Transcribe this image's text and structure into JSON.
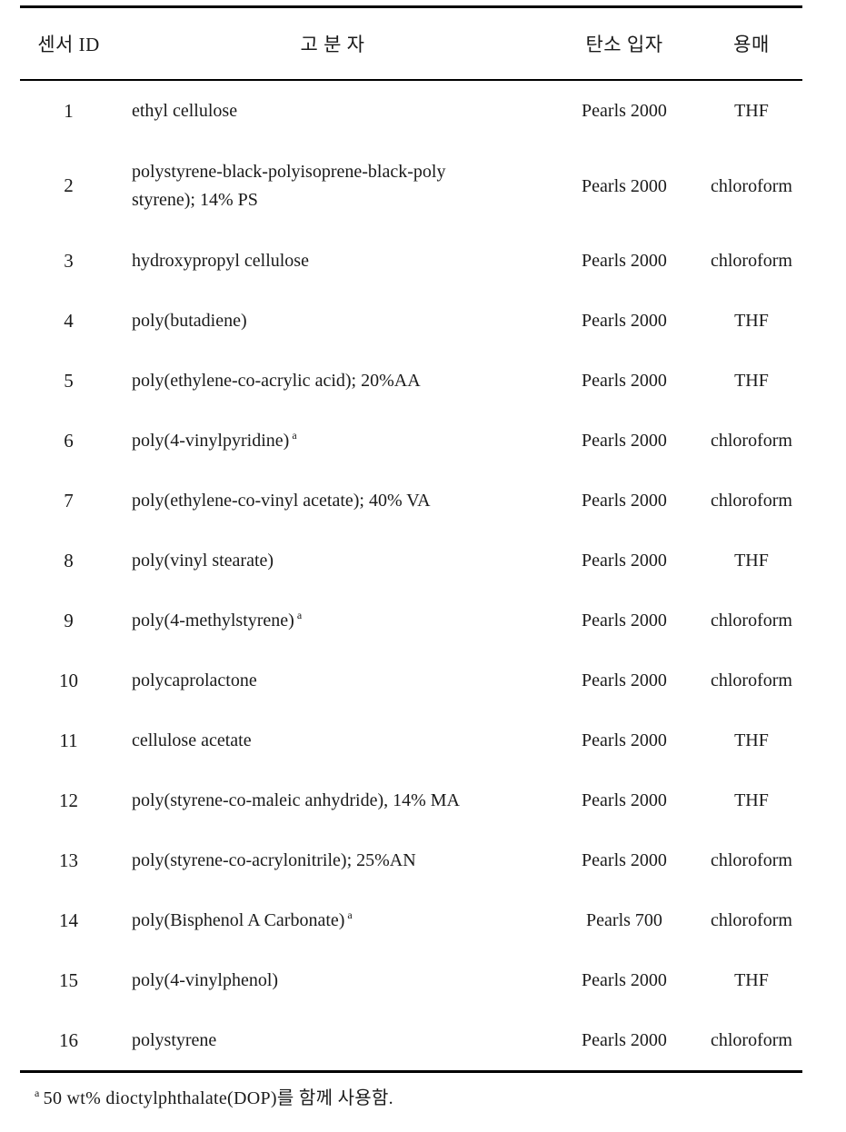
{
  "table": {
    "headers": {
      "sensor_id": "센서 ID",
      "polymer": "고 분 자",
      "carbon": "탄소 입자",
      "solvent": "용매"
    },
    "rows": [
      {
        "id": "1",
        "polymer_line1": "ethyl cellulose",
        "polymer_line2": "",
        "footnote_mark": "",
        "carbon": "Pearls 2000",
        "solvent": "THF"
      },
      {
        "id": "2",
        "polymer_line1": "polystyrene-black-polyisoprene-black-poly",
        "polymer_line2": "styrene); 14% PS",
        "footnote_mark": "",
        "carbon": "Pearls 2000",
        "solvent": "chloroform"
      },
      {
        "id": "3",
        "polymer_line1": "hydroxypropyl cellulose",
        "polymer_line2": "",
        "footnote_mark": "",
        "carbon": "Pearls 2000",
        "solvent": "chloroform"
      },
      {
        "id": "4",
        "polymer_line1": "poly(butadiene)",
        "polymer_line2": "",
        "footnote_mark": "",
        "carbon": "Pearls 2000",
        "solvent": "THF"
      },
      {
        "id": "5",
        "polymer_line1": "poly(ethylene-co-acrylic acid); 20%AA",
        "polymer_line2": "",
        "footnote_mark": "",
        "carbon": "Pearls 2000",
        "solvent": "THF"
      },
      {
        "id": "6",
        "polymer_line1": "poly(4-vinylpyridine)",
        "polymer_line2": "",
        "footnote_mark": "a",
        "carbon": "Pearls 2000",
        "solvent": "chloroform"
      },
      {
        "id": "7",
        "polymer_line1": "poly(ethylene-co-vinyl acetate); 40% VA",
        "polymer_line2": "",
        "footnote_mark": "",
        "carbon": "Pearls 2000",
        "solvent": "chloroform"
      },
      {
        "id": "8",
        "polymer_line1": "poly(vinyl stearate)",
        "polymer_line2": "",
        "footnote_mark": "",
        "carbon": "Pearls 2000",
        "solvent": "THF"
      },
      {
        "id": "9",
        "polymer_line1": "poly(4-methylstyrene)",
        "polymer_line2": "",
        "footnote_mark": "a",
        "carbon": "Pearls 2000",
        "solvent": "chloroform"
      },
      {
        "id": "10",
        "polymer_line1": "polycaprolactone",
        "polymer_line2": "",
        "footnote_mark": "",
        "carbon": "Pearls 2000",
        "solvent": "chloroform"
      },
      {
        "id": "11",
        "polymer_line1": "cellulose acetate",
        "polymer_line2": "",
        "footnote_mark": "",
        "carbon": "Pearls 2000",
        "solvent": "THF"
      },
      {
        "id": "12",
        "polymer_line1": "poly(styrene-co-maleic anhydride), 14% MA",
        "polymer_line2": "",
        "footnote_mark": "",
        "carbon": "Pearls 2000",
        "solvent": "THF"
      },
      {
        "id": "13",
        "polymer_line1": "poly(styrene-co-acrylonitrile); 25%AN",
        "polymer_line2": "",
        "footnote_mark": "",
        "carbon": "Pearls 2000",
        "solvent": "chloroform"
      },
      {
        "id": "14",
        "polymer_line1": "poly(Bisphenol A Carbonate)",
        "polymer_line2": "",
        "footnote_mark": "a",
        "carbon": "Pearls 700",
        "solvent": "chloroform"
      },
      {
        "id": "15",
        "polymer_line1": "poly(4-vinylphenol)",
        "polymer_line2": "",
        "footnote_mark": "",
        "carbon": "Pearls 2000",
        "solvent": "THF"
      },
      {
        "id": "16",
        "polymer_line1": "polystyrene",
        "polymer_line2": "",
        "footnote_mark": "",
        "carbon": "Pearls 2000",
        "solvent": "chloroform"
      }
    ]
  },
  "footnote": {
    "mark": "a",
    "text": "50 wt% dioctylphthalate(DOP)를 함께 사용함."
  },
  "colors": {
    "text": "#1a1a1a",
    "rule": "#000000",
    "background": "#ffffff"
  }
}
